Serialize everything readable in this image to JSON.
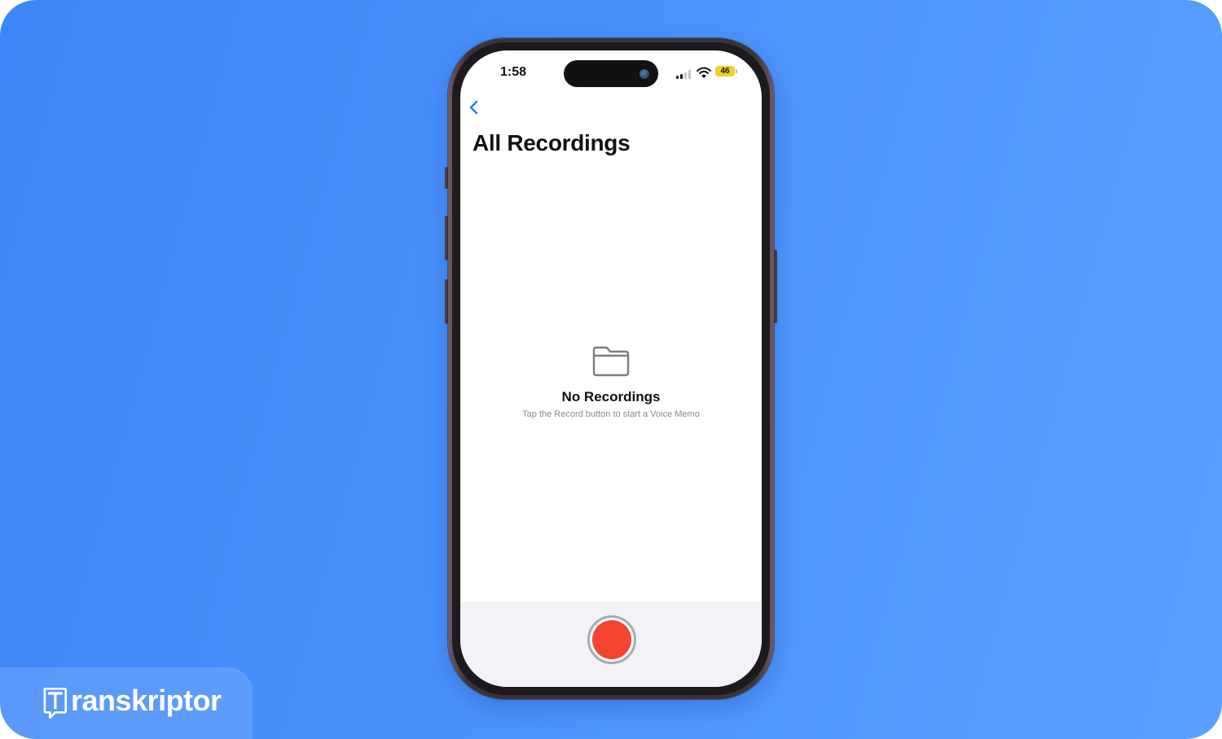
{
  "status_bar": {
    "time": "1:58",
    "battery": "46"
  },
  "nav": {
    "title": "All Recordings"
  },
  "empty_state": {
    "title": "No Recordings",
    "subtitle": "Tap the Record button to start a Voice Memo",
    "icon": "folder-icon"
  },
  "toolbar": {
    "record_icon": "record-icon"
  },
  "brand": {
    "name": "ranskriptor",
    "mark_letter": "T"
  },
  "colors": {
    "background": "#4a92fb",
    "record": "#f4442f",
    "accent": "#1a7cf5",
    "battery": "#f2cf25"
  }
}
